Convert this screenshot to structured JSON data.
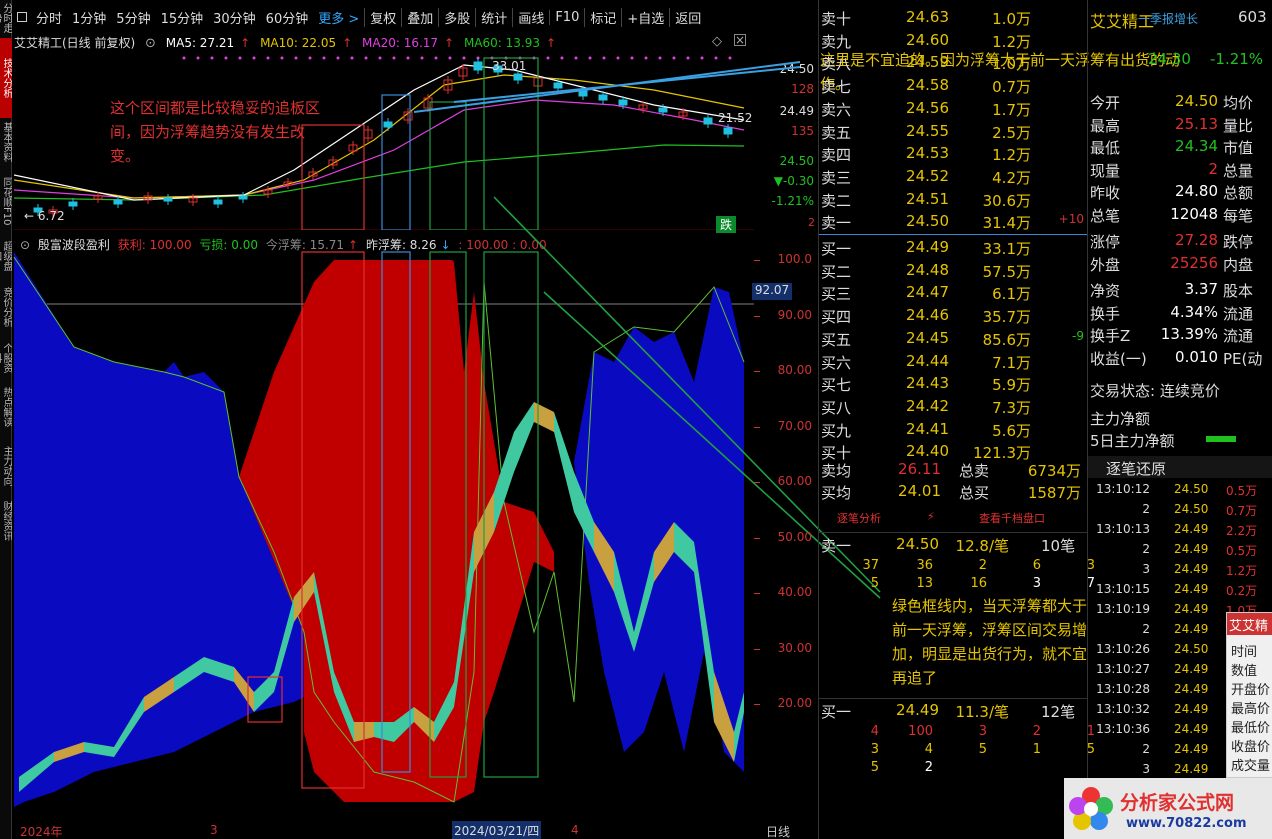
{
  "toolbar": {
    "items": [
      "分时",
      "1分钟",
      "5分钟",
      "15分钟",
      "30分钟",
      "60分钟",
      "更多 >",
      "复权",
      "叠加",
      "多股",
      "统计",
      "画线",
      "F10",
      "标记",
      "+自选",
      "返回"
    ]
  },
  "sidebar": {
    "items": [
      "分时走势",
      "技术分析",
      "基本资料",
      "同花顺F10",
      "超级盘口",
      "竞价分析",
      "个股资料",
      "热点解读",
      "主力动向",
      "财经资讯"
    ]
  },
  "main_chart": {
    "title": "艾艾精工(日线 前复权)",
    "ma5": "MA5: 27.21",
    "ma10": "MA10: 22.05",
    "ma20": "MA20: 16.17",
    "ma60": "MA60: 13.93",
    "high_label": "33.01",
    "low_label": "6.72",
    "right_label": "21.52",
    "right_axis": [
      "24.50",
      "128",
      "24.49",
      "135",
      "24.50",
      "▼-0.30",
      "-1.21%",
      "跌"
    ],
    "colors": {
      "ma5": "#ffffff",
      "ma10": "#e5c400",
      "ma20": "#e040e0",
      "ma60": "#20c020",
      "up": "#e03030",
      "down": "#20c0e0"
    }
  },
  "indicator": {
    "name": "殷富波段盈利",
    "profit": "获利: 100.00",
    "loss": "亏损: 0.00",
    "today_float": "今浮筹: 15.71",
    "yesterday_float": "昨浮筹: 8.26",
    "extra": ": 100.00 : 0.00",
    "axis": [
      "100.0",
      "90.00",
      "80.00",
      "70.00",
      "60.00",
      "50.00",
      "40.00",
      "30.00",
      "20.00"
    ],
    "current_value": "92.07"
  },
  "date_bar": {
    "start": "2024年",
    "m3": "3",
    "selected": "2024/03/21/四",
    "m4": "4",
    "period": "日线"
  },
  "order_book": {
    "sell": [
      {
        "label": "卖十",
        "price": "24.63",
        "vol": "1.0万",
        "chg": ""
      },
      {
        "label": "卖九",
        "price": "24.60",
        "vol": "1.2万",
        "chg": ""
      },
      {
        "label": "卖八",
        "price": "24.59",
        "vol": "1.0万",
        "chg": ""
      },
      {
        "label": "卖七",
        "price": "24.58",
        "vol": "0.7万",
        "chg": ""
      },
      {
        "label": "卖六",
        "price": "24.56",
        "vol": "1.7万",
        "chg": ""
      },
      {
        "label": "卖五",
        "price": "24.55",
        "vol": "2.5万",
        "chg": ""
      },
      {
        "label": "卖四",
        "price": "24.53",
        "vol": "1.2万",
        "chg": ""
      },
      {
        "label": "卖三",
        "price": "24.52",
        "vol": "4.2万",
        "chg": ""
      },
      {
        "label": "卖二",
        "price": "24.51",
        "vol": "30.6万",
        "chg": ""
      },
      {
        "label": "卖一",
        "price": "24.50",
        "vol": "31.4万",
        "chg": "+10"
      }
    ],
    "buy": [
      {
        "label": "买一",
        "price": "24.49",
        "vol": "33.1万",
        "chg": ""
      },
      {
        "label": "买二",
        "price": "24.48",
        "vol": "57.5万",
        "chg": ""
      },
      {
        "label": "买三",
        "price": "24.47",
        "vol": "6.1万",
        "chg": ""
      },
      {
        "label": "买四",
        "price": "24.46",
        "vol": "35.7万",
        "chg": ""
      },
      {
        "label": "买五",
        "price": "24.45",
        "vol": "85.6万",
        "chg": "-9"
      },
      {
        "label": "买六",
        "price": "24.44",
        "vol": "7.1万",
        "chg": ""
      },
      {
        "label": "买七",
        "price": "24.43",
        "vol": "5.9万",
        "chg": ""
      },
      {
        "label": "买八",
        "price": "24.42",
        "vol": "7.3万",
        "chg": ""
      },
      {
        "label": "买九",
        "price": "24.41",
        "vol": "5.6万",
        "chg": ""
      },
      {
        "label": "买十",
        "price": "24.40",
        "vol": "121.3万",
        "chg": ""
      }
    ],
    "avg_sell_label": "卖均",
    "avg_sell": "26.11",
    "total_sell_label": "总卖",
    "total_sell": "6734万",
    "avg_buy_label": "买均",
    "avg_buy": "24.01",
    "total_buy_label": "总买",
    "total_buy": "1587万",
    "tabs": [
      "逐笔分析",
      "⚡",
      "查看千档盘口"
    ],
    "sell1_label": "卖一",
    "sell1_price": "24.50",
    "sell1_per": "12.8/笔",
    "sell1_count": "10笔",
    "sell1_rows": [
      [
        "37",
        "36",
        "2",
        "6",
        "3"
      ],
      [
        "5",
        "13",
        "16",
        "3",
        "7"
      ]
    ],
    "buy1_label": "买一",
    "buy1_price": "24.49",
    "buy1_per": "11.3/笔",
    "buy1_count": "12笔",
    "buy1_rows": [
      [
        "4",
        "100",
        "3",
        "2",
        "1"
      ],
      [
        "3",
        "4",
        "5",
        "1",
        "5"
      ],
      [
        "5",
        "2",
        "",
        "",
        ""
      ]
    ]
  },
  "stats": {
    "stock_name": "艾艾精工",
    "tag": "一季报增长",
    "code": "603",
    "price": "24.30",
    "pct": "-1.21%",
    "rows": [
      {
        "l": "今开",
        "v": "24.50",
        "l2": "均价"
      },
      {
        "l": "最高",
        "v": "25.13",
        "l2": "量比"
      },
      {
        "l": "最低",
        "v": "24.34",
        "l2": "市值"
      },
      {
        "l": "现量",
        "v": "2",
        "l2": "总量"
      },
      {
        "l": "昨收",
        "v": "24.80",
        "l2": "总额"
      },
      {
        "l": "总笔",
        "v": "12048",
        "l2": "每笔"
      },
      {
        "l": "涨停",
        "v": "27.28",
        "l2": "跌停"
      },
      {
        "l": "外盘",
        "v": "25256",
        "l2": "内盘"
      },
      {
        "l": "净资",
        "v": "3.37",
        "l2": "股本"
      },
      {
        "l": "换手",
        "v": "4.34%",
        "l2": "流通"
      },
      {
        "l": "换手Z",
        "v": "13.39%",
        "l2": "流通"
      },
      {
        "l": "收益(一)",
        "v": "0.010",
        "l2": "PE(动"
      }
    ],
    "trade_status": "交易状态: 连续竞价",
    "main_net": "主力净额",
    "main_net5": "5日主力净额",
    "ticks_title": "逐笔还原",
    "ticks": [
      {
        "t": "13:10:12",
        "p": "24.50",
        "v": "0.5万"
      },
      {
        "t": "2",
        "p": "24.50",
        "v": "0.7万"
      },
      {
        "t": "13:10:13",
        "p": "24.49",
        "v": "2.2万"
      },
      {
        "t": "2",
        "p": "24.49",
        "v": "0.5万"
      },
      {
        "t": "3",
        "p": "24.49",
        "v": "1.2万"
      },
      {
        "t": "13:10:15",
        "p": "24.49",
        "v": "0.2万"
      },
      {
        "t": "13:10:19",
        "p": "24.49",
        "v": "1.0万"
      },
      {
        "t": "2",
        "p": "24.49",
        "v": ""
      },
      {
        "t": "13:10:26",
        "p": "24.50",
        "v": ""
      },
      {
        "t": "13:10:27",
        "p": "24.49",
        "v": ""
      },
      {
        "t": "13:10:28",
        "p": "24.49",
        "v": ""
      },
      {
        "t": "13:10:32",
        "p": "24.49",
        "v": ""
      },
      {
        "t": "13:10:36",
        "p": "24.49",
        "v": ""
      },
      {
        "t": "2",
        "p": "24.49",
        "v": ""
      },
      {
        "t": "3",
        "p": "24.49",
        "v": ""
      }
    ],
    "popup_title": "艾艾精",
    "popup_rows": [
      "时间",
      "数值",
      "开盘价",
      "最高价",
      "最低价",
      "收盘价",
      "成交量"
    ]
  },
  "annotations": {
    "a1": "这个区间都是比较稳妥的追板区间，因为浮筹趋势没有发生改变。",
    "a2": "这里是不宜追的。因为浮筹大于前一天浮筹有出货的动作。",
    "a3": "绿色框线内，当天浮筹都大于前一天浮筹，浮筹区间交易增加，明显是出货行为，就不宜再追了"
  },
  "watermark": {
    "text1": "分析家公式网",
    "text2": "www.70822.com"
  }
}
